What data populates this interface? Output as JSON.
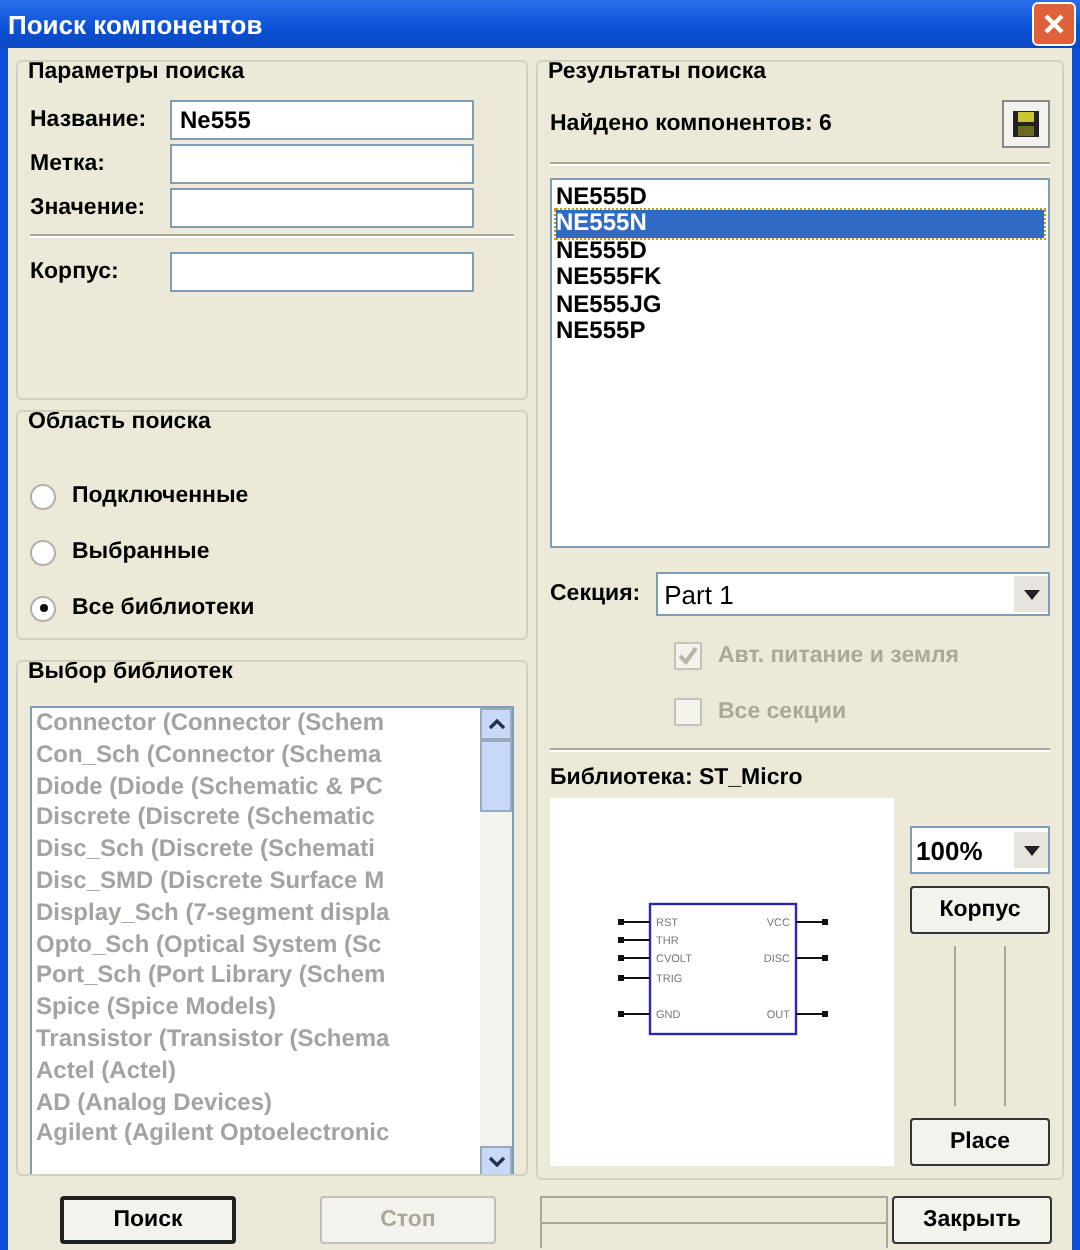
{
  "window": {
    "title": "Поиск компонентов"
  },
  "search_params": {
    "title": "Параметры поиска",
    "fields": [
      {
        "label": "Название:",
        "value": "Ne555"
      },
      {
        "label": "Метка:"
      },
      {
        "label": "Значение:"
      }
    ],
    "package_field": {
      "label": "Корпус:"
    }
  },
  "scope": {
    "title": "Область поиска",
    "options": [
      {
        "label": "Подключенные",
        "selected": false
      },
      {
        "label": "Выбранные",
        "selected": false
      },
      {
        "label": "Все библиотеки",
        "selected": true
      }
    ]
  },
  "libraries": {
    "title": "Выбор библиотек",
    "disabled": true,
    "items": [
      "Connector (Connector (Schem",
      "Con_Sch (Connector (Schema",
      "Diode (Diode (Schematic & PC",
      "Discrete (Discrete (Schematic",
      "Disc_Sch (Discrete (Schemati",
      "Disc_SMD (Discrete Surface M",
      "Display_Sch (7-segment displa",
      "Opto_Sch (Optical System (Sc",
      "Port_Sch (Port Library (Schem",
      "Spice (Spice Models)",
      "Transistor (Transistor (Schema",
      "Actel (Actel)",
      "AD (Analog Devices)",
      "Agilent (Agilent Optoelectronic"
    ]
  },
  "buttons": [
    {
      "label": "Поиск",
      "disabled": false
    },
    {
      "label": "Стоп",
      "disabled": true
    }
  ],
  "results": {
    "title": "Результаты поиска",
    "count_text": "Найдено компонентов: 6",
    "items": [
      {
        "label": "NE555D",
        "selected": false
      },
      {
        "label": "NE555N",
        "selected": true
      },
      {
        "label": "NE555D",
        "selected": false
      },
      {
        "label": "NE555FK",
        "selected": false
      },
      {
        "label": "NE555JG",
        "selected": false
      },
      {
        "label": "NE555P",
        "selected": false
      }
    ],
    "section_label": "Секция:",
    "section_value": "Part 1",
    "options": [
      {
        "label": "Авт. питание и земля",
        "checked": true,
        "disabled": true
      },
      {
        "label": "Все секции",
        "checked": false,
        "disabled": true
      }
    ],
    "library_text": "Библиотека: ST_Micro",
    "pins_left": [
      "RST",
      "THR",
      "CVOLT",
      "TRIG",
      "GND"
    ],
    "pins_right": [
      "VCC",
      "DISC",
      "OUT"
    ],
    "zoom": "100%",
    "package_button": "Корпус",
    "place_button": "Place"
  },
  "close_button": "Закрыть"
}
